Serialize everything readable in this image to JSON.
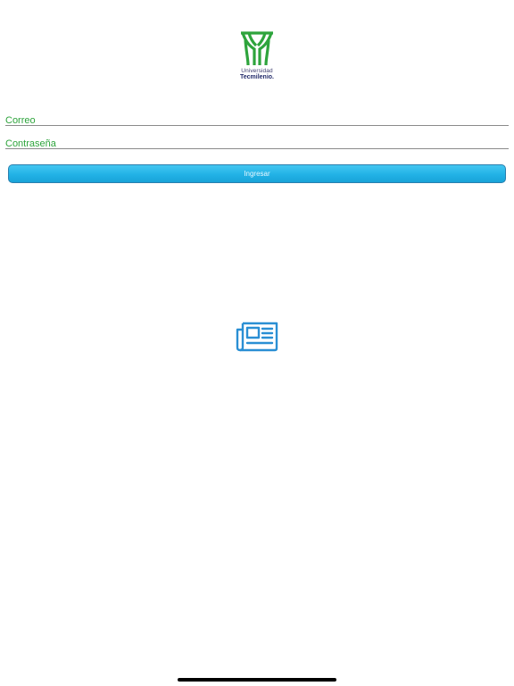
{
  "logo": {
    "line1": "Universidad",
    "line2": "Tecmilenio."
  },
  "form": {
    "email_placeholder": "Correo",
    "password_placeholder": "Contraseña",
    "submit_label": "Ingresar"
  },
  "icons": {
    "logo": "tecmilenio-tree-logo",
    "news": "newspaper-icon"
  },
  "colors": {
    "brand_green": "#2ea43c",
    "brand_navy": "#232b6b",
    "button_blue": "#22b2e6",
    "icon_blue": "#2a8fd4"
  }
}
